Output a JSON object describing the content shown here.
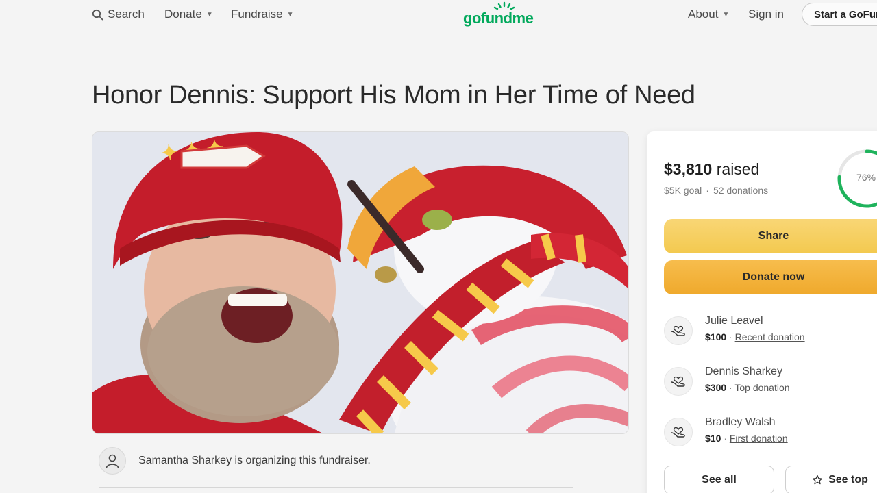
{
  "nav": {
    "search_label": "Search",
    "donate_label": "Donate",
    "fundraise_label": "Fundraise",
    "about_label": "About",
    "signin_label": "Sign in",
    "start_label": "Start a GoFundMe"
  },
  "brand": {
    "logo_text": "gofundme",
    "color": "#02a95c"
  },
  "campaign": {
    "title": "Honor Dennis: Support His Mom in Her Time of Need",
    "organizer_text": "Samantha Sharkey is organizing this fundraiser."
  },
  "progress": {
    "raised": "$3,810",
    "raised_suffix": " raised",
    "goal": "$5K goal",
    "separator": "·",
    "donations": "52 donations",
    "percent_label": "76%",
    "fraction": 0.76
  },
  "actions": {
    "share_label": "Share",
    "donate_label": "Donate now",
    "see_all_label": "See all",
    "see_top_label": "See top"
  },
  "donors": [
    {
      "name": "Julie Leavel",
      "amount": "$100",
      "tag": "Recent donation"
    },
    {
      "name": "Dennis Sharkey",
      "amount": "$300",
      "tag": "Top donation"
    },
    {
      "name": "Bradley Walsh",
      "amount": "$10",
      "tag": "First donation"
    }
  ],
  "colors": {
    "share": "#f3c94f",
    "donate": "#efa92c",
    "ring": "#1fb35c"
  },
  "icons": {
    "search": "search-icon",
    "caret": "chevron-down-icon",
    "donor": "heart-hands-icon",
    "organizer": "user-icon",
    "star": "star-icon"
  }
}
